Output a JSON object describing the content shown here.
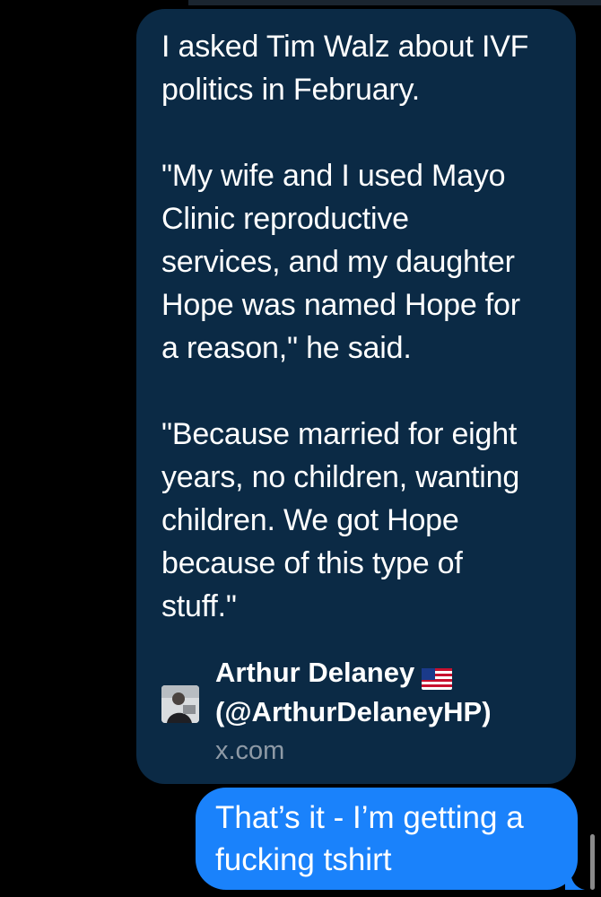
{
  "conversation": {
    "link_preview": {
      "quote_paragraphs": [
        "I asked Tim Walz about IVF\npolitics in February.",
        "\"My wife and I used Mayo\nClinic reproductive\nservices, and my daughter\nHope was named Hope for\na reason,\" he said.",
        "\"Because married for eight\nyears, no children, wanting\nchildren. We got Hope\nbecause of this type of\nstuff.\""
      ],
      "author_name": "Arthur Delaney",
      "author_handle": "(@ArthurDelaneyHP)",
      "domain": "x.com",
      "flag_icon": "us-flag-icon",
      "bubble_color": "#0b2a45"
    },
    "sent_message": {
      "text": "That’s it - I’m getting a\nfucking tshirt",
      "bubble_color": "#1a82fb"
    }
  }
}
